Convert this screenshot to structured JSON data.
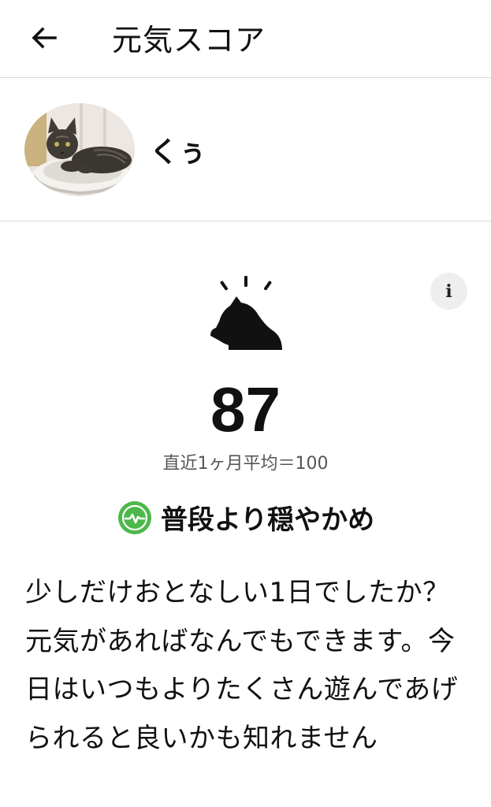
{
  "header": {
    "title": "元気スコア",
    "back_icon": "arrow-left-icon"
  },
  "pet": {
    "name": "くぅ",
    "avatar_icon": "cat-photo"
  },
  "score": {
    "value": "87",
    "average_text": "直近1ヶ月平均＝100",
    "icon": "cat-silhouette-icon",
    "info_label": "i"
  },
  "status": {
    "label": "普段より穏やかめ",
    "icon": "pulse-icon",
    "color": "#4cb84a"
  },
  "message": {
    "text": "少しだけおとなしい1日でしたか？ 元気があればなんでもできます。今日はいつもよりたくさん遊んであげられると良いかも知れません"
  }
}
